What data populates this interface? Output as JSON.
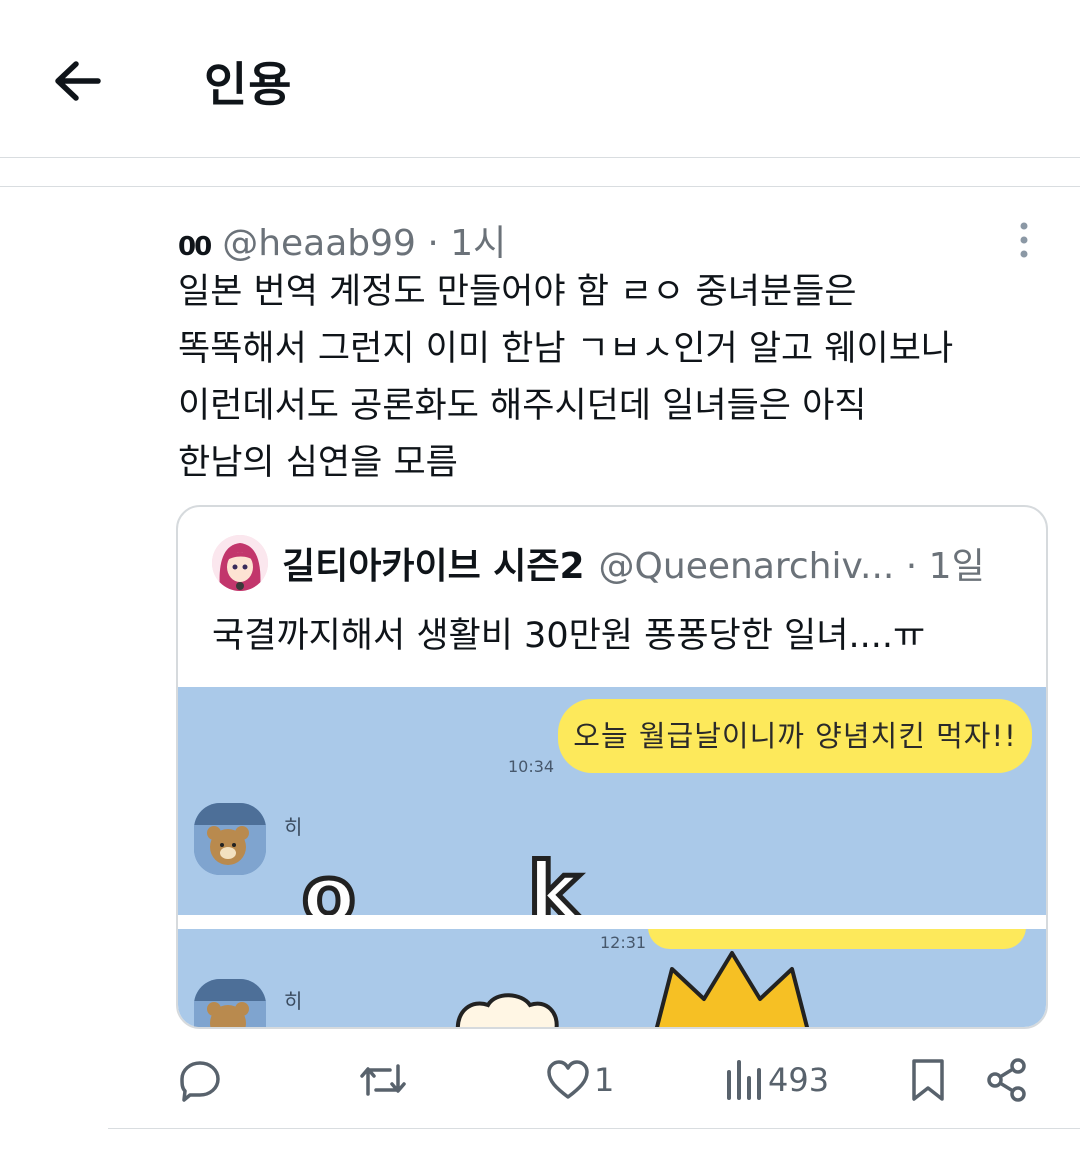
{
  "header": {
    "title": "인용"
  },
  "tweet": {
    "display_name": "00",
    "handle": "@heaab99",
    "time": " · 1시",
    "text_lines": [
      "일본 번역 계정도 만들어야 함 ㄹㅇ 중녀분들은",
      "똑똑해서 그런지 이미 한남 ㄱㅂㅅ인거 알고 웨이보나",
      "이런데서도 공론화도 해주시던데 일녀들은 아직",
      "한남의 심연을 모름"
    ]
  },
  "quote": {
    "display_name": "길티아카이브 시즌2",
    "handle": "@Queenarchiv...",
    "time": " · 1일",
    "text": "국결까지해서 생활비 30만원 퐁퐁당한 일녀....ㅠ",
    "chat": {
      "bubble_text": "오늘 월급날이니까 양념치킨 먹자!!",
      "time1": "10:34",
      "time2": "12:31",
      "sender_name": "히",
      "letter_o": "o",
      "letter_k": "k"
    }
  },
  "actions": {
    "replies": "",
    "retweets": "",
    "likes": "1",
    "views": "493"
  },
  "icons": {
    "back": "arrow-left-icon",
    "more": "more-vertical-icon",
    "reply": "reply-icon",
    "retweet": "retweet-icon",
    "like": "heart-icon",
    "views": "views-icon",
    "bookmark": "bookmark-icon",
    "share": "share-icon"
  }
}
